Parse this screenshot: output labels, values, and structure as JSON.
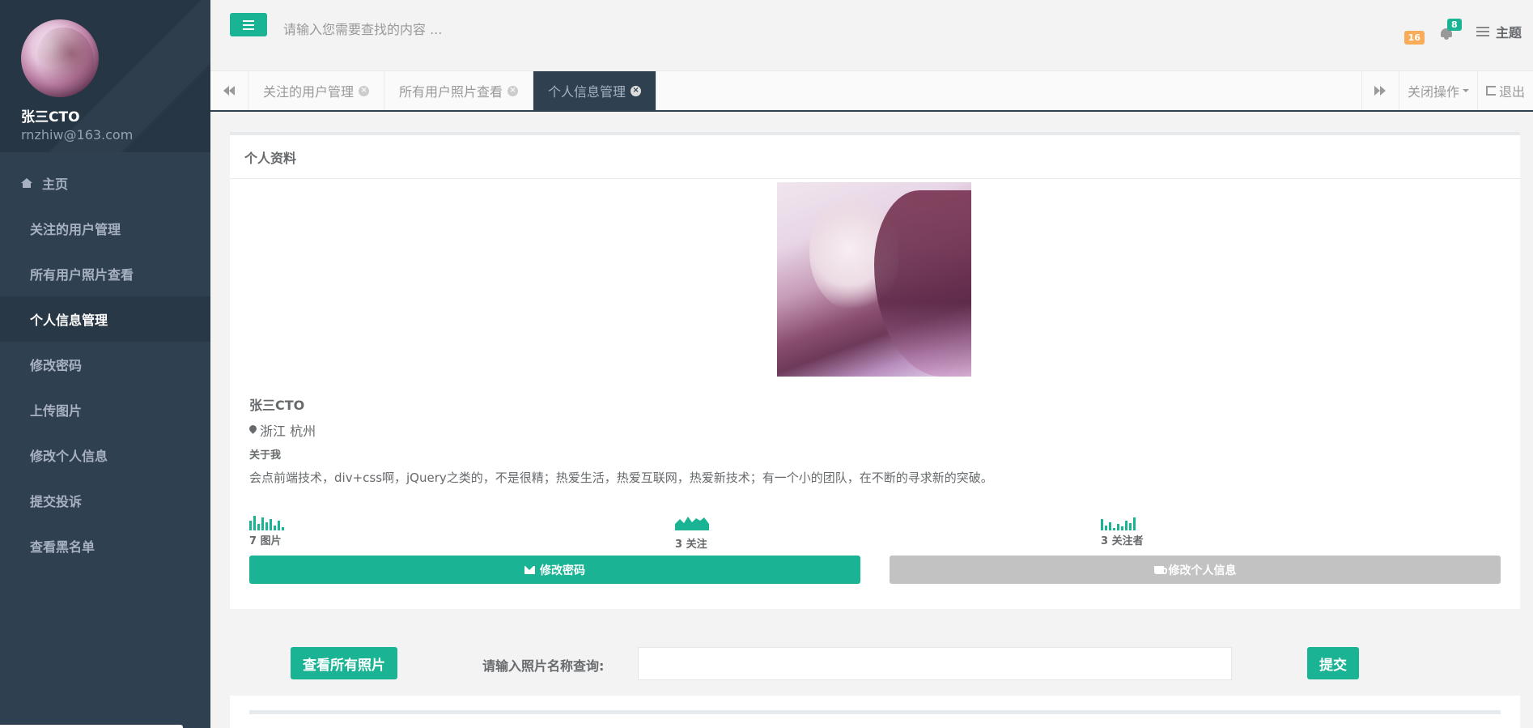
{
  "sidebar": {
    "profile": {
      "name": "张三CTO",
      "email": "rnzhiw@163.com"
    },
    "items": [
      {
        "label": "主页",
        "icon": "home-icon"
      },
      {
        "label": "关注的用户管理"
      },
      {
        "label": "所有用户照片查看"
      },
      {
        "label": "个人信息管理",
        "active": true
      },
      {
        "label": "修改密码"
      },
      {
        "label": "上传图片"
      },
      {
        "label": "修改个人信息"
      },
      {
        "label": "提交投诉"
      },
      {
        "label": "查看黑名单"
      }
    ]
  },
  "header": {
    "search_placeholder": "请输入您需要查找的内容 ...",
    "orange_badge": "16",
    "notification_count": "8",
    "theme_label": "主题"
  },
  "tabs": {
    "items": [
      {
        "label": "关注的用户管理"
      },
      {
        "label": "所有用户照片查看"
      },
      {
        "label": "个人信息管理",
        "active": true
      }
    ],
    "close_ops_label": "关闭操作",
    "logout_label": "退出"
  },
  "profile_panel": {
    "title": "个人资料",
    "name": "张三CTO",
    "location": "浙江 杭州",
    "about_label": "关于我",
    "about_text": "会点前端技术，div+css啊，jQuery之类的，不是很精；热爱生活，热爱互联网，热爱新技术；有一个小的团队，在不断的寻求新的突破。",
    "stats": [
      {
        "label": "7 图片",
        "chart": "bar"
      },
      {
        "label": "3 关注",
        "chart": "area"
      },
      {
        "label": "3 关注者",
        "chart": "bar"
      }
    ],
    "change_password_label": "修改密码",
    "edit_info_label": "修改个人信息"
  },
  "photo_search": {
    "view_all_label": "查看所有照片",
    "query_label": "请输入照片名称查询:",
    "query_value": "",
    "submit_label": "提交"
  },
  "colors": {
    "accent": "#1ab394",
    "sidebar": "#2f4050",
    "badge_orange": "#f8ac59",
    "disabled_button": "#c2c2c2"
  }
}
